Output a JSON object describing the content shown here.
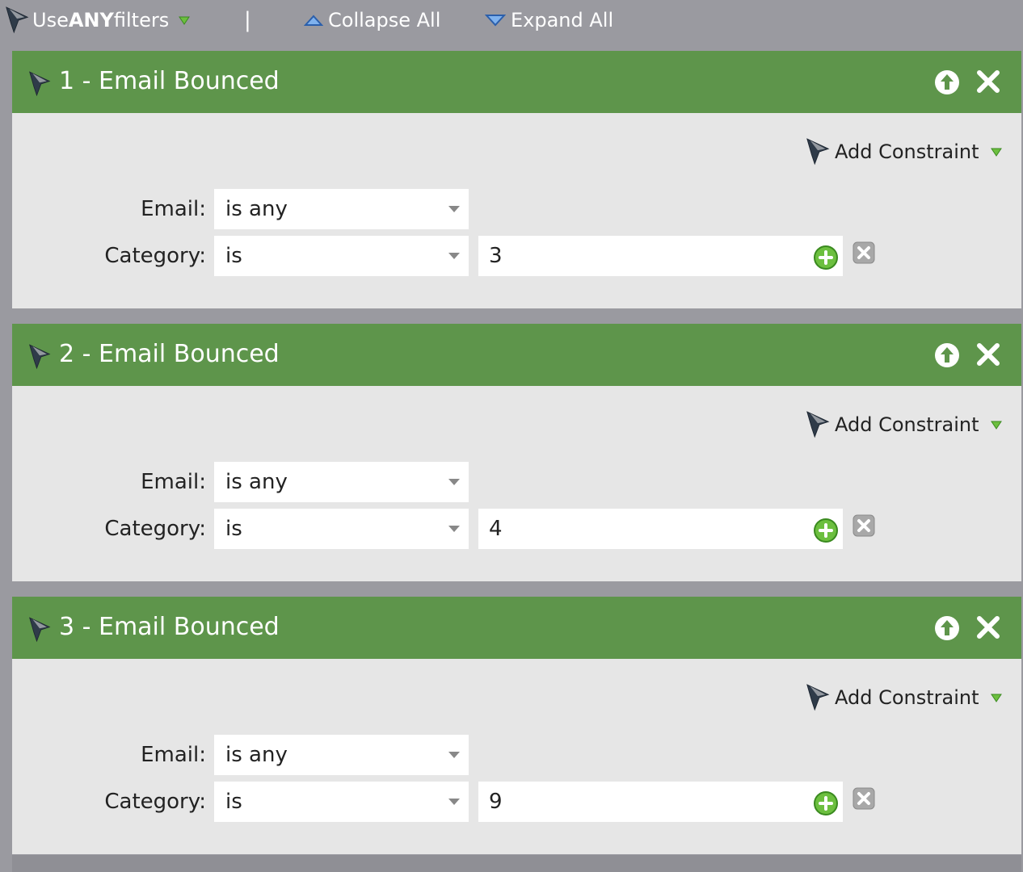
{
  "toolbar": {
    "logic_prefix": "Use ",
    "logic_strong": "ANY",
    "logic_suffix": " filters",
    "separator": "|",
    "collapse_label": "Collapse All",
    "expand_label": "Expand All"
  },
  "add_constraint_label": "Add Constraint",
  "filters": [
    {
      "title": "1 - Email Bounced",
      "rows": [
        {
          "label": "Email:",
          "operator": "is any",
          "value": null
        },
        {
          "label": "Category:",
          "operator": "is",
          "value": "3"
        }
      ]
    },
    {
      "title": "2 - Email Bounced",
      "rows": [
        {
          "label": "Email:",
          "operator": "is any",
          "value": null
        },
        {
          "label": "Category:",
          "operator": "is",
          "value": "4"
        }
      ]
    },
    {
      "title": "3 - Email Bounced",
      "rows": [
        {
          "label": "Email:",
          "operator": "is any",
          "value": null
        },
        {
          "label": "Category:",
          "operator": "is",
          "value": "9"
        }
      ]
    }
  ],
  "colors": {
    "background": "#9a9aa0",
    "header_green": "#5e954b",
    "card_body": "#e6e6e6",
    "accent_green": "#6cbf3f",
    "toolbar_triangle_blue": "#3a7bd5"
  },
  "icons": {
    "filter_logic": "funnel-icon",
    "collapse": "triangle-up-icon",
    "expand": "triangle-down-icon",
    "header_funnel": "funnel-icon",
    "move_up": "arrow-up-circle-icon",
    "remove_filter": "close-icon",
    "add_value": "plus-circle-icon",
    "remove_constraint": "x-box-icon"
  }
}
